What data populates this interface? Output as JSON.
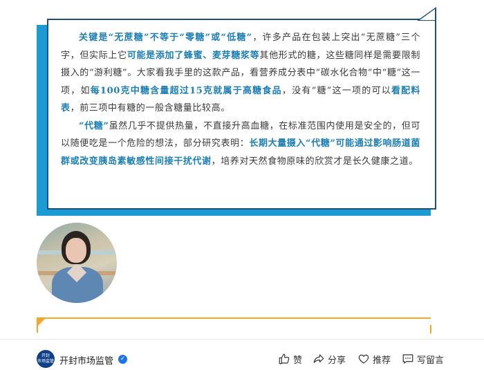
{
  "article": {
    "p1": {
      "s1": "关键是“无蔗糖”不等于“零糖”或“低糖”",
      "s2": "，许多产品在包装上突出“无蔗糖”三个字，但实际上它",
      "s3": "可能是添加了蜂蜜、麦芽糖浆等",
      "s4": "其他形式的糖，这些糖同样是需要限制摄入的“游利糖”。大家看我手里的这款产品，看营养成分表中“碳水化合物”中“糖”这一项，如",
      "s5": "每100克中糖含量超过15克就属于高糖食品",
      "s6": "，没有“糖”这一项的可以",
      "s7": "看配料表",
      "s8": "，前三项中有糖的一般含糖量比较高。"
    },
    "p2": {
      "s1": "“代糖”",
      "s2": "虽然几乎不提供热量，不直接升高血糖，在标准范围内使用是安全的，但可以随便吃是一个危险的想法，部分研究表明：",
      "s3": "长期大量摄入“代糖”可能通过影响肠道菌群或改变胰岛素敏感性间接干扰代谢",
      "s4": "，培养对天然食物原味的欣赏才是长久健康之道。"
    }
  },
  "account": {
    "logo_text_1": "开封",
    "logo_text_2": "市场监管",
    "name": "开封市场监管",
    "verified_icon": "check"
  },
  "actions": {
    "like": "赞",
    "share": "分享",
    "recommend": "推荐",
    "comment": "写留言"
  },
  "colors": {
    "highlight": "#1e7fb3",
    "card_shadow": "#1c9ad3",
    "card_border": "#1d4f7a",
    "accent_orange": "#f6a42c"
  }
}
